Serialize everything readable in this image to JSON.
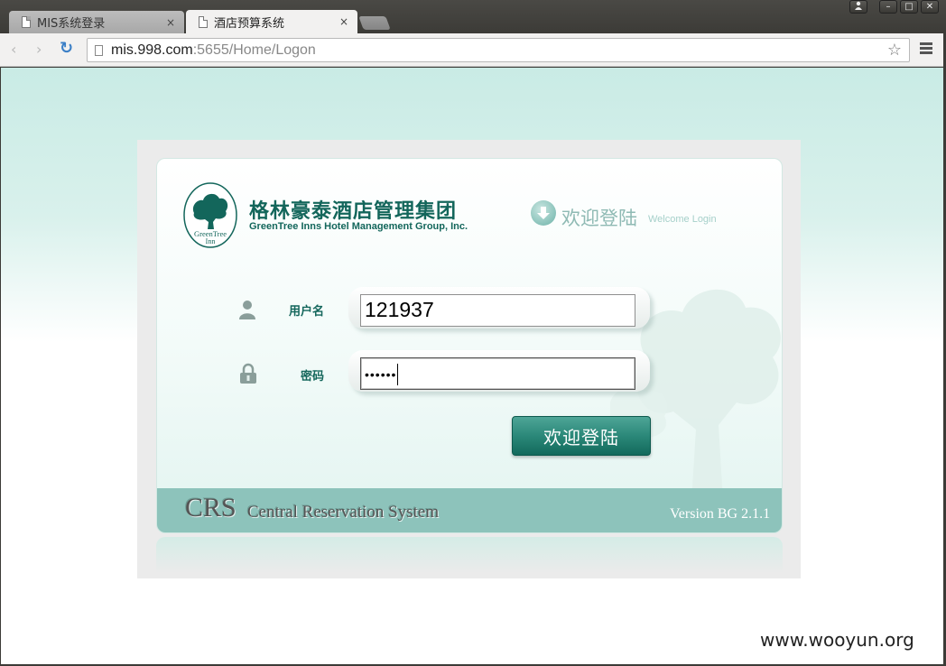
{
  "browser": {
    "tabs": [
      {
        "title": "MIS系统登录",
        "close": "×",
        "active": false
      },
      {
        "title": "酒店预算系统",
        "close": "×",
        "active": true
      }
    ],
    "url": {
      "host": "mis.998.com",
      "path": ":5655/Home/Logon"
    },
    "nav_icons": {
      "back": "‹",
      "forward": "›",
      "reload": "↻",
      "star": "☆"
    },
    "window_controls": {
      "user": "👤",
      "minimize": "–",
      "maximize": "□",
      "close": "✕"
    }
  },
  "page": {
    "logo": {
      "seal_text_top": "GreenTree",
      "seal_text_bottom": "Inn",
      "company_cn": "格林豪泰酒店管理集团",
      "company_en": "GreenTree Inns Hotel Management Group, Inc."
    },
    "welcome": {
      "cn": "欢迎登陆",
      "en": "Welcome Login"
    },
    "form": {
      "username_label": "用户名",
      "username_value": "121937",
      "password_label": "密码",
      "password_mask": "••••••"
    },
    "login_button": "欢迎登陆",
    "footer": {
      "crs": "CRS",
      "system_name": "Central Reservation System",
      "version": "Version BG 2.1.1"
    },
    "colors": {
      "brand": "#13665b",
      "footer_bar": "#8dc3bb",
      "button": "#2b8879"
    }
  },
  "watermark": "www.wooyun.org"
}
